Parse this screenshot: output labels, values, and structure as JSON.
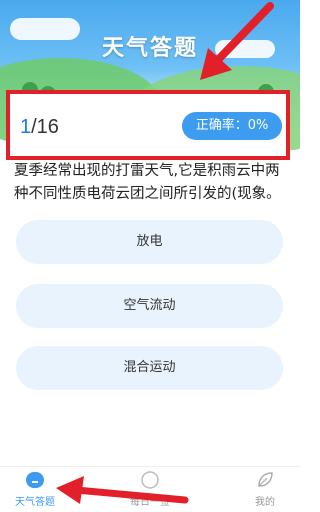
{
  "header": {
    "title": "天气答题"
  },
  "progress": {
    "current": "1",
    "total": "/16",
    "accuracy": "正确率：0%"
  },
  "question": {
    "text": "夏季经常出现的打雷天气,它是积雨云中两种不同性质电荷云团之间所引发的(现象。"
  },
  "options": [
    {
      "label": "放电"
    },
    {
      "label": "空气流动"
    },
    {
      "label": "混合运动"
    }
  ],
  "nav": {
    "items": [
      {
        "label": "天气答题",
        "icon": "quiz-icon",
        "active": true
      },
      {
        "label": "每日一签",
        "icon": "daily-sign-icon",
        "active": false
      },
      {
        "label": "我的",
        "icon": "leaf-icon",
        "active": false
      }
    ]
  },
  "colors": {
    "accent": "#3d9bf0",
    "highlight": "#e1202a",
    "option_bg": "#e9f3fd"
  }
}
